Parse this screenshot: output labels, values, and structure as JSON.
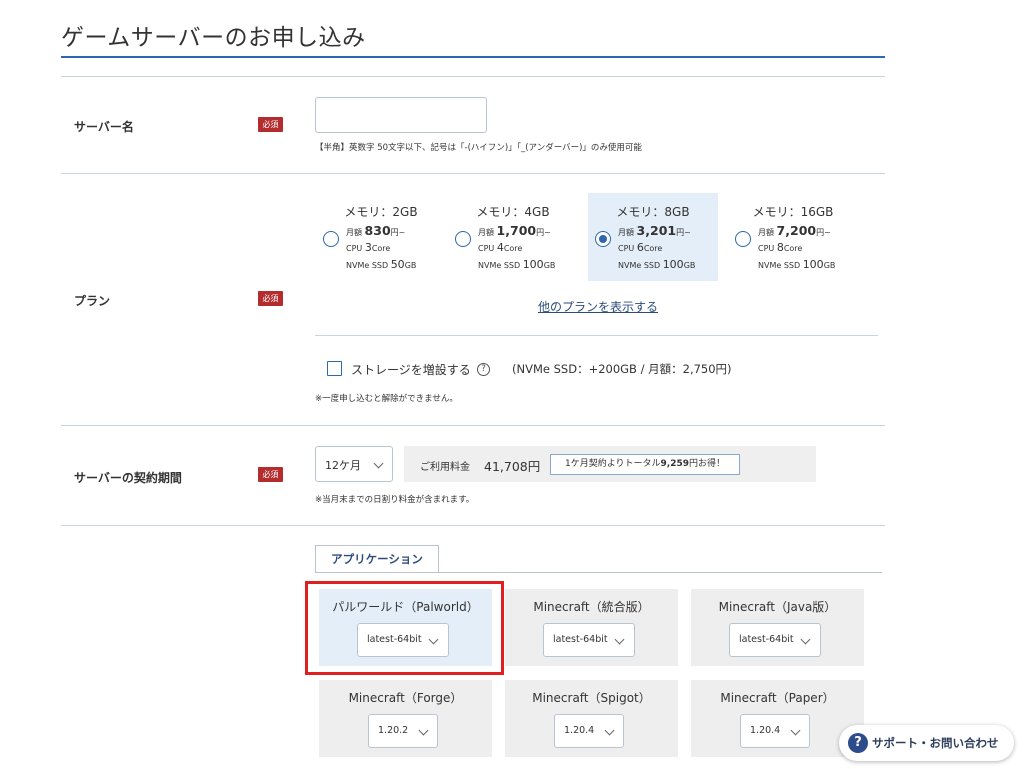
{
  "page": {
    "title": "ゲームサーバーのお申し込み"
  },
  "required_badge": "必須",
  "server_name": {
    "label": "サーバー名",
    "value": "",
    "hint": "【半角】英数字 50文字以下、記号は「-(ハイフン)」「_(アンダーバー)」のみ使用可能"
  },
  "plan": {
    "label": "プラン",
    "cards": [
      {
        "memory": "メモリ：2GB",
        "month_label": "月額",
        "price": "830",
        "price_unit": "円~",
        "cpu_label": "CPU",
        "cpu": "3",
        "cpu_unit": "Core",
        "ssd_label": "NVMe SSD",
        "ssd": "50",
        "ssd_unit": "GB",
        "selected": false
      },
      {
        "memory": "メモリ：4GB",
        "month_label": "月額",
        "price": "1,700",
        "price_unit": "円~",
        "cpu_label": "CPU",
        "cpu": "4",
        "cpu_unit": "Core",
        "ssd_label": "NVMe SSD",
        "ssd": "100",
        "ssd_unit": "GB",
        "selected": false
      },
      {
        "memory": "メモリ：8GB",
        "month_label": "月額",
        "price": "3,201",
        "price_unit": "円~",
        "cpu_label": "CPU",
        "cpu": "6",
        "cpu_unit": "Core",
        "ssd_label": "NVMe SSD",
        "ssd": "100",
        "ssd_unit": "GB",
        "selected": true
      },
      {
        "memory": "メモリ：16GB",
        "month_label": "月額",
        "price": "7,200",
        "price_unit": "円~",
        "cpu_label": "CPU",
        "cpu": "8",
        "cpu_unit": "Core",
        "ssd_label": "NVMe SSD",
        "ssd": "100",
        "ssd_unit": "GB",
        "selected": false
      }
    ],
    "more_link": "他のプランを表示する",
    "storage_label": "ストレージを増設する",
    "storage_note": "(NVMe SSD：+200GB / 月額：2,750円)",
    "storage_checked": false,
    "storage_warning": "※一度申し込むと解除ができません。"
  },
  "period": {
    "label": "サーバーの契約期間",
    "selected": "12ケ月",
    "fee_label": "ご利用料金",
    "fee_amount": "41,708円",
    "save_prefix": "1ケ月契約よりトータル",
    "save_amount": "9,259",
    "save_suffix": "円お得！",
    "note": "※当月末までの日割り料金が含まれます。"
  },
  "apps": {
    "tab_label": "アプリケーション",
    "items": [
      {
        "name": "パルワールド（Palworld）",
        "version": "latest-64bit",
        "selected": true
      },
      {
        "name": "Minecraft（統合版）",
        "version": "latest-64bit",
        "selected": false
      },
      {
        "name": "Minecraft（Java版）",
        "version": "latest-64bit",
        "selected": false
      },
      {
        "name": "Minecraft（Forge）",
        "version": "1.20.2",
        "selected": false
      },
      {
        "name": "Minecraft（Spigot）",
        "version": "1.20.4",
        "selected": false
      },
      {
        "name": "Minecraft（Paper）",
        "version": "1.20.4",
        "selected": false
      }
    ]
  },
  "support": {
    "label": "サポート・お問い合わせ"
  },
  "colors": {
    "accent": "#2c68ad",
    "required": "#b32d2e",
    "highlight": "#e02020",
    "selected_bg": "#e3eef9"
  }
}
